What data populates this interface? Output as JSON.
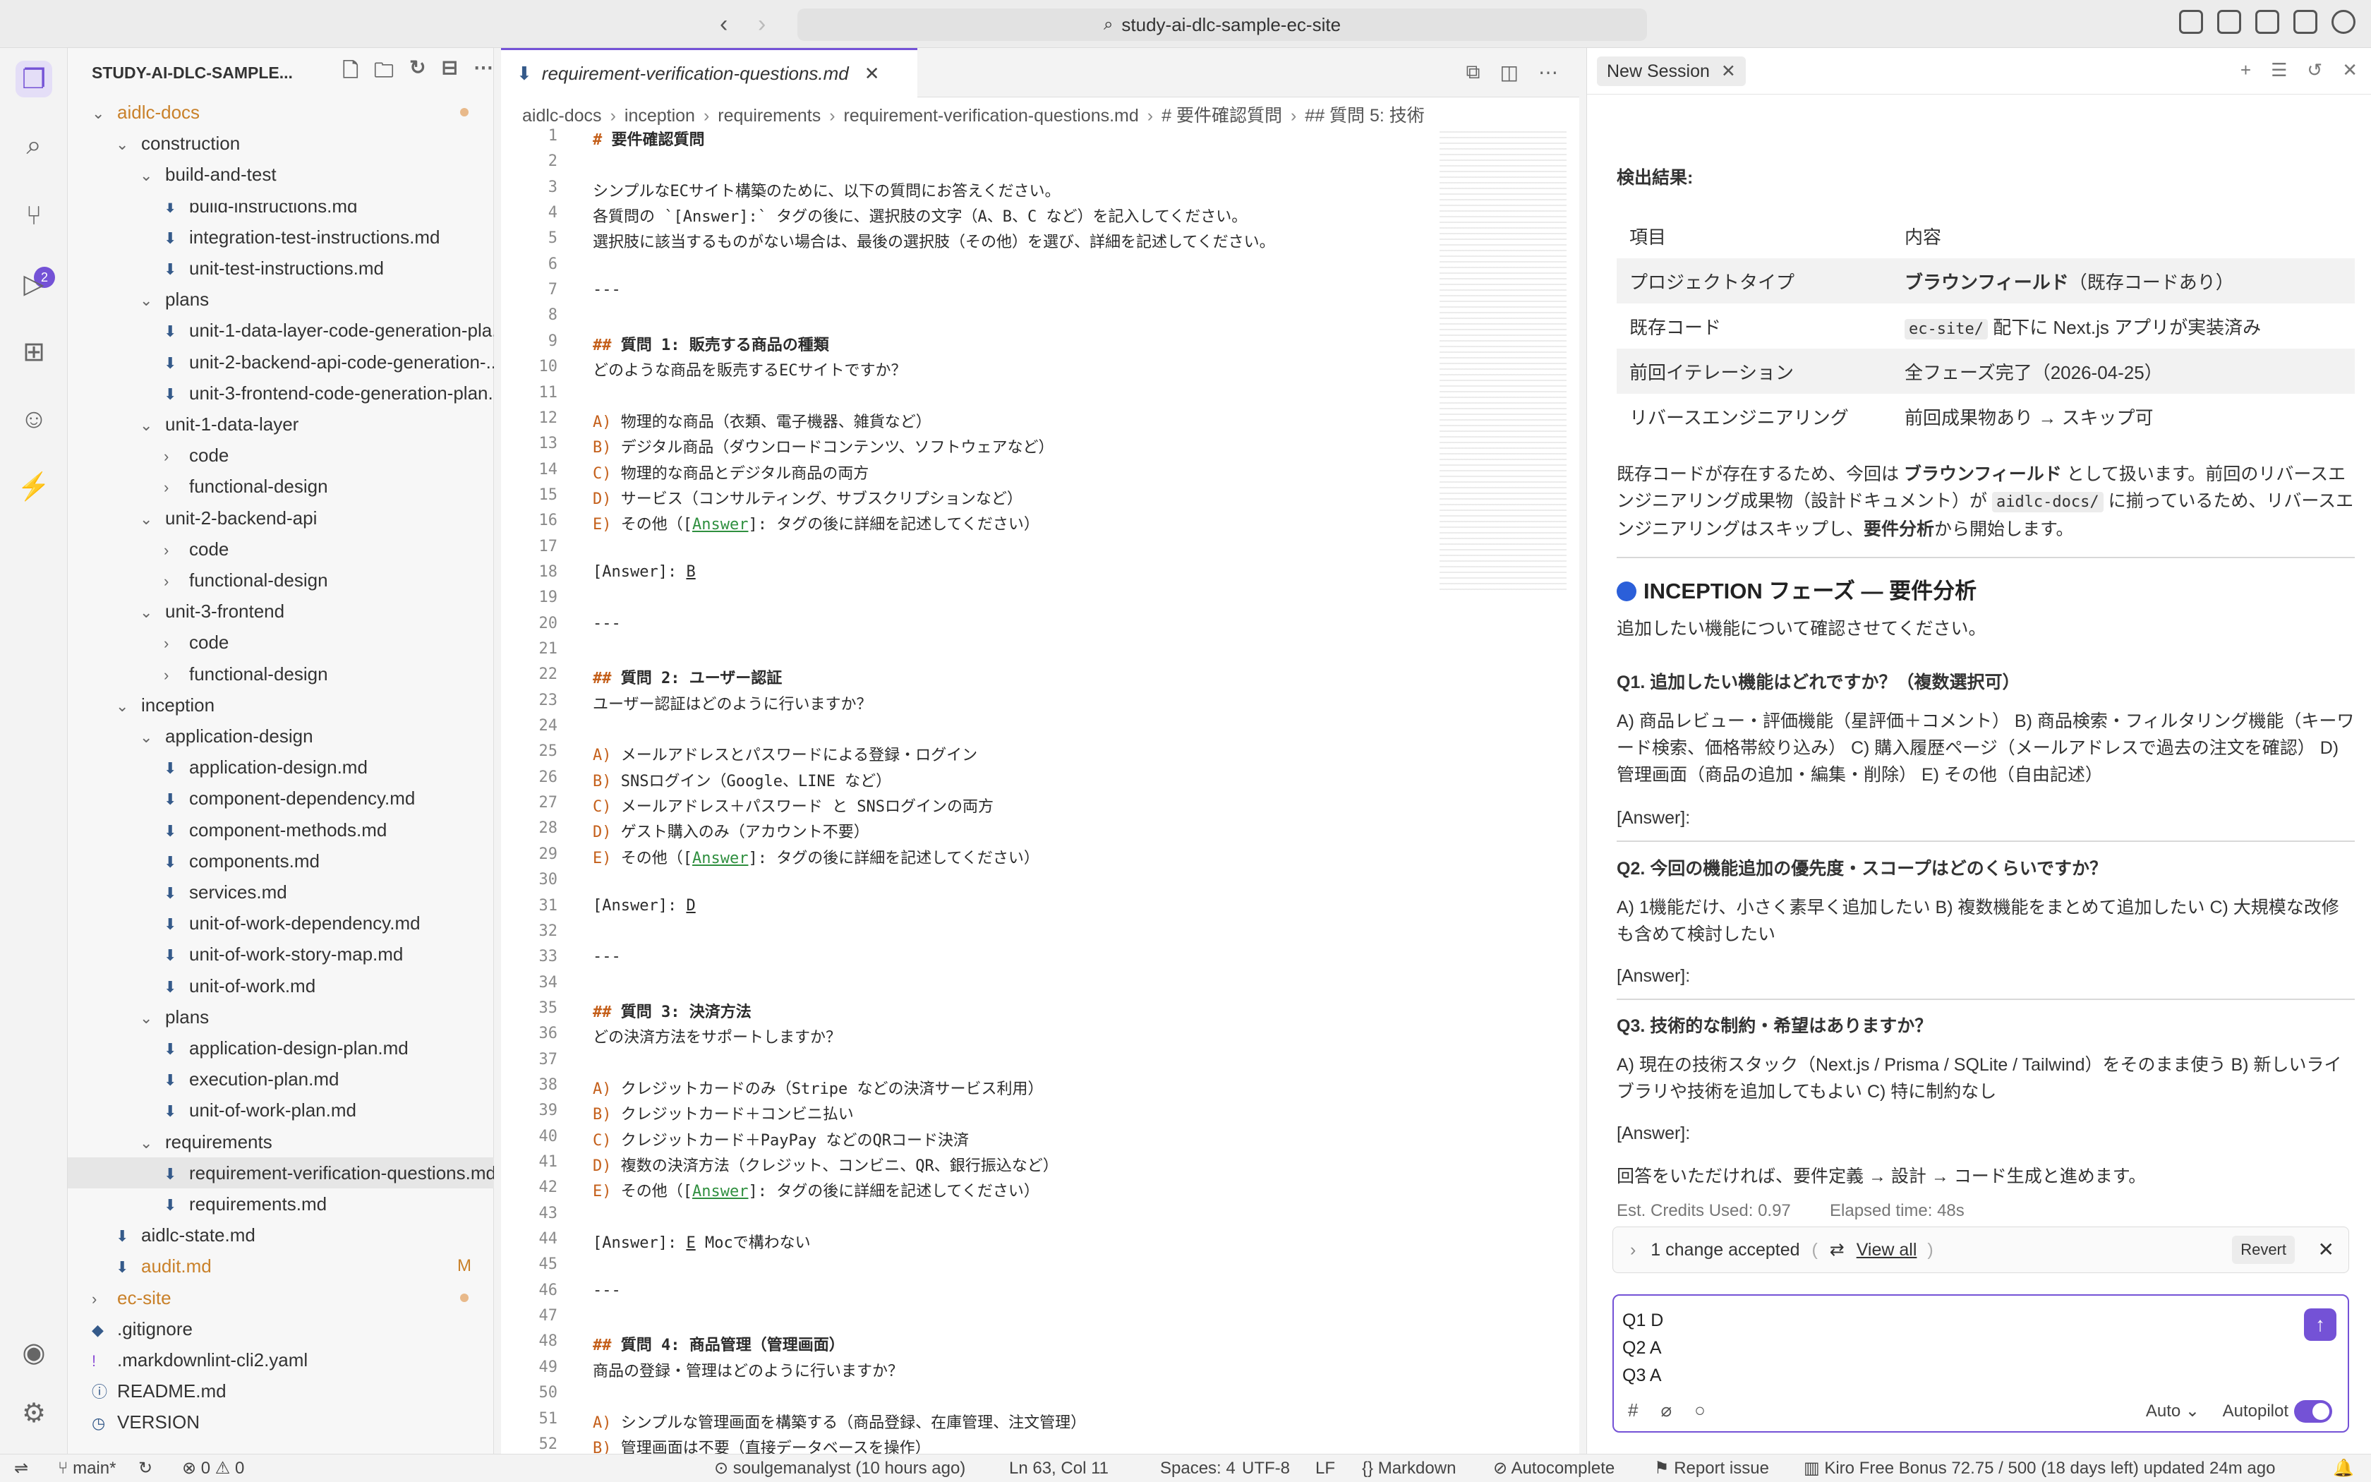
{
  "window": {
    "search_text": "study-ai-dlc-sample-ec-site"
  },
  "activity_bar": {
    "scm_badge": "2"
  },
  "explorer": {
    "title": "STUDY-AI-DLC-SAMPLE...",
    "tree": [
      {
        "label": "aidlc-docs",
        "modified": true,
        "dot": true
      },
      {
        "label": "construction"
      },
      {
        "label": "build-and-test"
      },
      {
        "label": "build-instructions.md"
      },
      {
        "label": "integration-test-instructions.md"
      },
      {
        "label": "unit-test-instructions.md"
      },
      {
        "label": "plans"
      },
      {
        "label": "unit-1-data-layer-code-generation-pla..."
      },
      {
        "label": "unit-2-backend-api-code-generation-..."
      },
      {
        "label": "unit-3-frontend-code-generation-plan..."
      },
      {
        "label": "unit-1-data-layer"
      },
      {
        "label": "code"
      },
      {
        "label": "functional-design"
      },
      {
        "label": "unit-2-backend-api"
      },
      {
        "label": "code"
      },
      {
        "label": "functional-design"
      },
      {
        "label": "unit-3-frontend"
      },
      {
        "label": "code"
      },
      {
        "label": "functional-design"
      },
      {
        "label": "inception"
      },
      {
        "label": "application-design"
      },
      {
        "label": "application-design.md"
      },
      {
        "label": "component-dependency.md"
      },
      {
        "label": "component-methods.md"
      },
      {
        "label": "components.md"
      },
      {
        "label": "services.md"
      },
      {
        "label": "unit-of-work-dependency.md"
      },
      {
        "label": "unit-of-work-story-map.md"
      },
      {
        "label": "unit-of-work.md"
      },
      {
        "label": "plans"
      },
      {
        "label": "application-design-plan.md"
      },
      {
        "label": "execution-plan.md"
      },
      {
        "label": "unit-of-work-plan.md"
      },
      {
        "label": "requirements"
      },
      {
        "label": "requirement-verification-questions.md"
      },
      {
        "label": "requirements.md"
      },
      {
        "label": "aidlc-state.md"
      },
      {
        "label": "audit.md",
        "badge": "M"
      },
      {
        "label": "ec-site"
      },
      {
        "label": ".gitignore"
      },
      {
        "label": ".markdownlint-cli2.yaml"
      },
      {
        "label": "README.md"
      },
      {
        "label": "VERSION"
      }
    ]
  },
  "editor": {
    "tab_label": "requirement-verification-questions.md",
    "breadcrumb": [
      "aidlc-docs",
      "inception",
      "requirements",
      "requirement-verification-questions.md",
      "# 要件確認質問",
      "## 質問 5: 技術"
    ],
    "lines": [
      "# 要件確認質問",
      "",
      "シンプルなECサイト構築のために、以下の質問にお答えください。",
      "各質問の `[Answer]:` タグの後に、選択肢の文字（A、B、C など）を記入してください。",
      "選択肢に該当するものがない場合は、最後の選択肢（その他）を選び、詳細を記述してください。",
      "",
      "---",
      "",
      "## 質問 1: 販売する商品の種類",
      "どのような商品を販売するECサイトですか？",
      "",
      "A) 物理的な商品（衣類、電子機器、雑貨など）",
      "B) デジタル商品（ダウンロードコンテンツ、ソフトウェアなど）",
      "C) 物理的な商品とデジタル商品の両方",
      "D) サービス（コンサルティング、サブスクリプションなど）",
      "E) その他（[Answer]: タグの後に詳細を記述してください）",
      "",
      "[Answer]: B",
      "",
      "---",
      "",
      "## 質問 2: ユーザー認証",
      "ユーザー認証はどのように行いますか？",
      "",
      "A) メールアドレスとパスワードによる登録・ログイン",
      "B) SNSログイン（Google、LINE など）",
      "C) メールアドレス＋パスワード と SNSログインの両方",
      "D) ゲスト購入のみ（アカウント不要）",
      "E) その他（[Answer]: タグの後に詳細を記述してください）",
      "",
      "[Answer]: D",
      "",
      "---",
      "",
      "## 質問 3: 決済方法",
      "どの決済方法をサポートしますか？",
      "",
      "A) クレジットカードのみ（Stripe などの決済サービス利用）",
      "B) クレジットカード＋コンビニ払い",
      "C) クレジットカード＋PayPay などのQRコード決済",
      "D) 複数の決済方法（クレジット、コンビニ、QR、銀行振込など）",
      "E) その他（[Answer]: タグの後に詳細を記述してください）",
      "",
      "[Answer]: E Mocで構わない",
      "",
      "---",
      "",
      "## 質問 4: 商品管理（管理画面）",
      "商品の登録・管理はどのように行いますか？",
      "",
      "A) シンプルな管理画面を構築する（商品登録、在庫管理、注文管理）",
      "B) 管理画面は不要（直接データベースを操作）"
    ]
  },
  "chat": {
    "tab_label": "New Session",
    "detect_title": "検出結果:",
    "table_header": [
      "項目",
      "内容"
    ],
    "table_rows": [
      [
        "プロジェクトタイプ",
        "ブラウンフィールド",
        "（既存コードあり）"
      ],
      [
        "既存コード",
        "ec-site/",
        " 配下に Next.js アプリが実装済み"
      ],
      [
        "前回イテレーション",
        "全フェーズ完了（2026-04-25）",
        ""
      ],
      [
        "リバースエンジニアリング",
        "前回成果物あり → スキップ可",
        ""
      ]
    ],
    "para1": [
      "既存コードが存在するため、今回は ",
      "ブラウンフィールド",
      " として扱います。前回のリバースエンジニアリング成果物（設計ドキュメント）が ",
      "aidlc-docs/",
      " に揃っているため、リバースエンジニアリングはスキップし、",
      "要件分析",
      "から開始します。"
    ],
    "section_title": "INCEPTION フェーズ — 要件分析",
    "section_intro": "追加したい機能について確認させてください。",
    "q1_title": "Q1. 追加したい機能はどれですか？（複数選択可）",
    "q1_body": "A) 商品レビュー・評価機能（星評価＋コメント） B) 商品検索・フィルタリング機能（キーワード検索、価格帯絞り込み） C) 購入履歴ページ（メールアドレスで過去の注文を確認） D) 管理画面（商品の追加・編集・削除） E) その他（自由記述）",
    "answer_label": "[Answer]:",
    "q2_title": "Q2. 今回の機能追加の優先度・スコープはどのくらいですか？",
    "q2_body": "A) 1機能だけ、小さく素早く追加したい B) 複数機能をまとめて追加したい C) 大規模な改修も含めて検討したい",
    "q3_title": "Q3. 技術的な制約・希望はありますか？",
    "q3_body": "A) 現在の技術スタック（Next.js / Prisma / SQLite / Tailwind）をそのまま使う B) 新しいライブラリや技術を追加してもよい C) 特に制約なし",
    "closing": "回答をいただければ、要件定義 → 設計 → コード生成と進めます。",
    "credits": "Est. Credits Used: 0.97",
    "elapsed": "Elapsed time: 48s",
    "accepted_text": "1 change accepted",
    "view_all": "View all",
    "revert": "Revert",
    "input_text": "Q1 D\nQ2 A\nQ3 A",
    "mode": "Auto",
    "autopilot": "Autopilot"
  },
  "statusbar": {
    "branch": "main*",
    "problems": "0",
    "warnings": "0",
    "git_user": "soulgemanalyst (10 hours ago)",
    "position": "Ln 63, Col 11",
    "spaces": "Spaces: 4",
    "encoding": "UTF-8",
    "eol": "LF",
    "language": "Markdown",
    "autocomplete": "Autocomplete",
    "report": "Report issue",
    "bonus": "Kiro Free Bonus 72.75 / 500 (18 days left) updated 24m ago"
  },
  "colors": {
    "accent": "#7452d6",
    "modified": "#c9812a",
    "answer_link": "#2f8f3f",
    "heading_hash": "#c45f1a"
  }
}
